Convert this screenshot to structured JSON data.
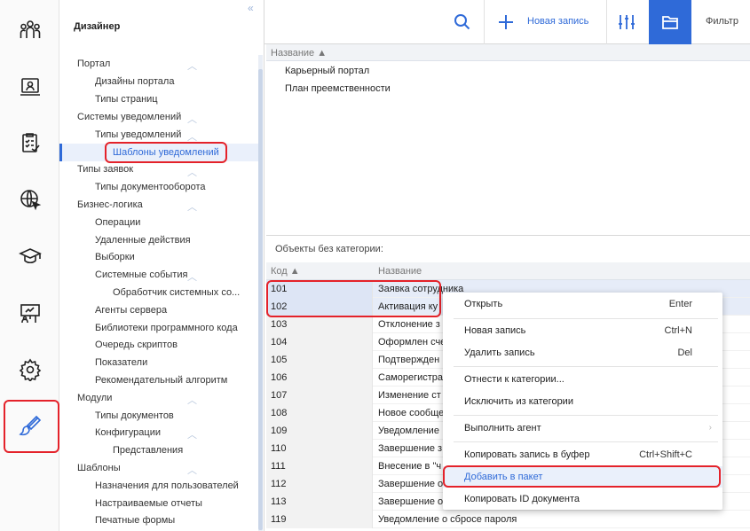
{
  "rail": {
    "icons": [
      "users-icon",
      "profile-card-icon",
      "checklist-icon",
      "globe-cursor-icon",
      "graduation-cap-icon",
      "presentation-icon",
      "gear-icon",
      "brush-icon"
    ]
  },
  "tree": {
    "title": "Дизайнер",
    "items": [
      {
        "label": "Портал"
      },
      {
        "label": "Дизайны портала"
      },
      {
        "label": "Типы страниц"
      },
      {
        "label": "Системы уведомлений"
      },
      {
        "label": "Типы уведомлений"
      },
      {
        "label": "Шаблоны уведомлений"
      },
      {
        "label": "Типы заявок"
      },
      {
        "label": "Типы документооборота"
      },
      {
        "label": "Бизнес-логика"
      },
      {
        "label": "Операции"
      },
      {
        "label": "Удаленные действия"
      },
      {
        "label": "Выборки"
      },
      {
        "label": "Системные события"
      },
      {
        "label": "Обработчик системных со..."
      },
      {
        "label": "Агенты сервера"
      },
      {
        "label": "Библиотеки программного кода"
      },
      {
        "label": "Очередь скриптов"
      },
      {
        "label": "Показатели"
      },
      {
        "label": "Рекомендательный алгоритм"
      },
      {
        "label": "Модули"
      },
      {
        "label": "Типы документов"
      },
      {
        "label": "Конфигурации"
      },
      {
        "label": "Представления"
      },
      {
        "label": "Шаблоны"
      },
      {
        "label": "Назначения для пользователей"
      },
      {
        "label": "Настраиваемые отчеты"
      },
      {
        "label": "Печатные формы"
      }
    ]
  },
  "toolbar": {
    "new_record": "Новая запись",
    "filter": "Фильтр"
  },
  "top_grid": {
    "header": "Название ▲",
    "rows": [
      "Карьерный портал",
      "План преемственности"
    ]
  },
  "section_label": "Объекты без категории:",
  "bottom_grid": {
    "col_code": "Код ▲",
    "col_name": "Название",
    "rows": [
      {
        "code": "101",
        "name": "Заявка сотрудника"
      },
      {
        "code": "102",
        "name": "Активация ку"
      },
      {
        "code": "103",
        "name": "Отклонение з"
      },
      {
        "code": "104",
        "name": "Оформлен сче"
      },
      {
        "code": "105",
        "name": "Подтвержден"
      },
      {
        "code": "106",
        "name": "Саморегистра"
      },
      {
        "code": "107",
        "name": "Изменение ст"
      },
      {
        "code": "108",
        "name": "Новое сообще"
      },
      {
        "code": "109",
        "name": "Уведомление"
      },
      {
        "code": "110",
        "name": "Завершение з"
      },
      {
        "code": "111",
        "name": "Внесение в \"ч"
      },
      {
        "code": "112",
        "name": "Завершение о"
      },
      {
        "code": "113",
        "name": "Завершение о"
      },
      {
        "code": "119",
        "name": "Уведомление о сбросе пароля"
      }
    ]
  },
  "context_menu": {
    "items": [
      {
        "label": "Открыть",
        "shortcut": "Enter"
      },
      {
        "label": "Новая запись",
        "shortcut": "Ctrl+N"
      },
      {
        "label": "Удалить запись",
        "shortcut": "Del"
      },
      {
        "label": "Отнести к категории...",
        "shortcut": ""
      },
      {
        "label": "Исключить из категории",
        "shortcut": ""
      },
      {
        "label": "Выполнить агент",
        "shortcut": ""
      },
      {
        "label": "Копировать запись в буфер",
        "shortcut": "Ctrl+Shift+C"
      },
      {
        "label": "Добавить в пакет",
        "shortcut": ""
      },
      {
        "label": "Копировать ID документа",
        "shortcut": ""
      }
    ]
  },
  "colors": {
    "accent": "#2f6ad8",
    "highlight_box": "#e4222a"
  }
}
